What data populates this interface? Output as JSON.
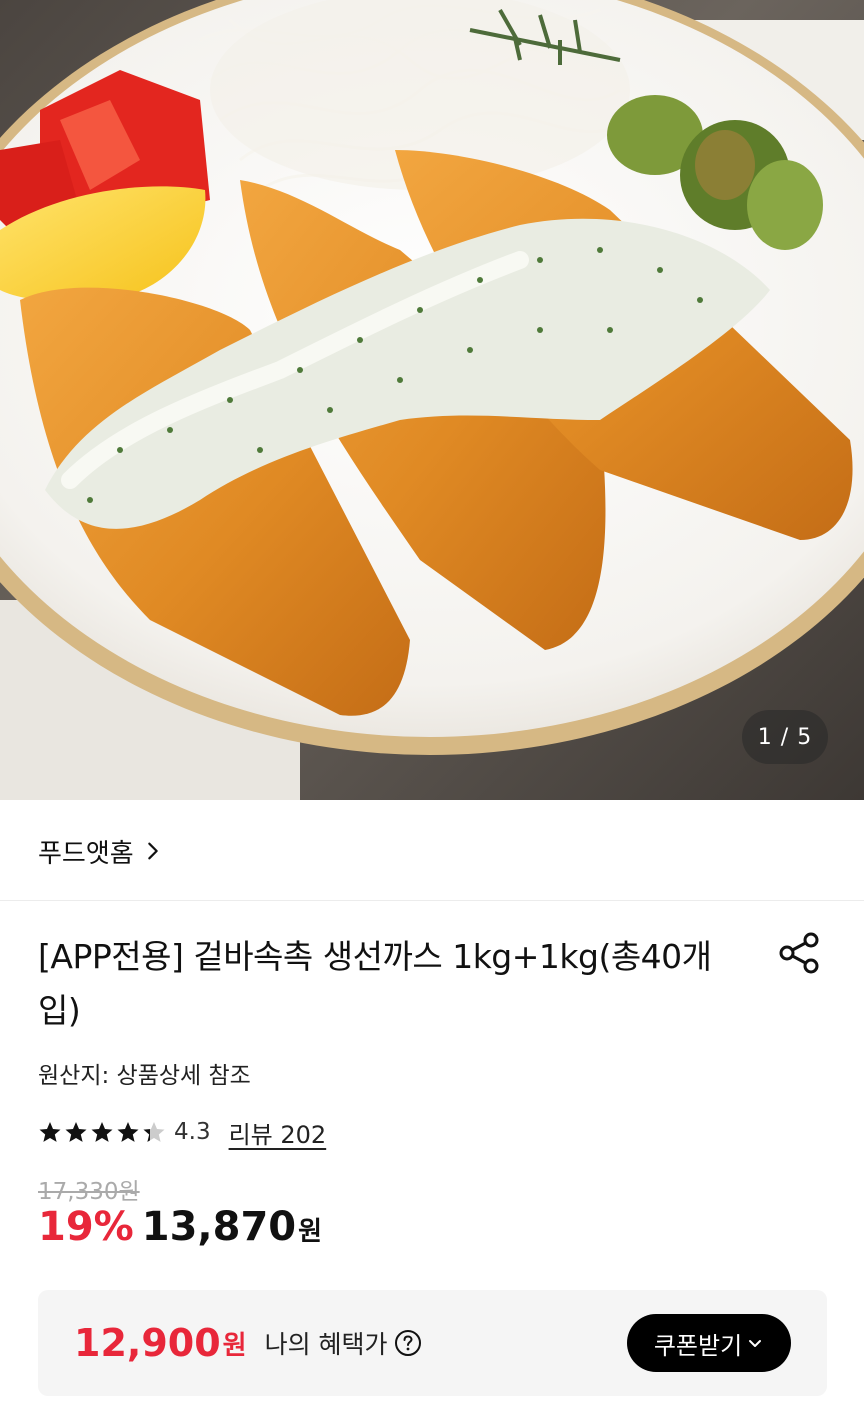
{
  "gallery": {
    "counter": "1 / 5"
  },
  "brand": {
    "name": "푸드앳홈",
    "chevron_icon": "chevron-right-icon"
  },
  "product": {
    "title": "[APP전용] 겉바속촉 생선까스 1kg+1kg(총40개입)",
    "share_icon": "share-icon",
    "origin": "원산지: 상품상세 참조"
  },
  "rating": {
    "score": 4.3,
    "score_label": "4.3",
    "review_link": "리뷰 202",
    "star_color": "#111111",
    "empty_star_color": "#cccccc"
  },
  "price": {
    "original": "17,330원",
    "discount": "19%",
    "final": "13,870",
    "currency": "원"
  },
  "benefit": {
    "price": "12,900",
    "currency": "원",
    "label": "나의 혜택가",
    "help_icon": "question-circle-icon",
    "coupon_button": "쿠폰받기",
    "coupon_icon": "chevron-down-icon"
  },
  "colors": {
    "accent_red": "#e8273a",
    "button_black": "#000000"
  }
}
